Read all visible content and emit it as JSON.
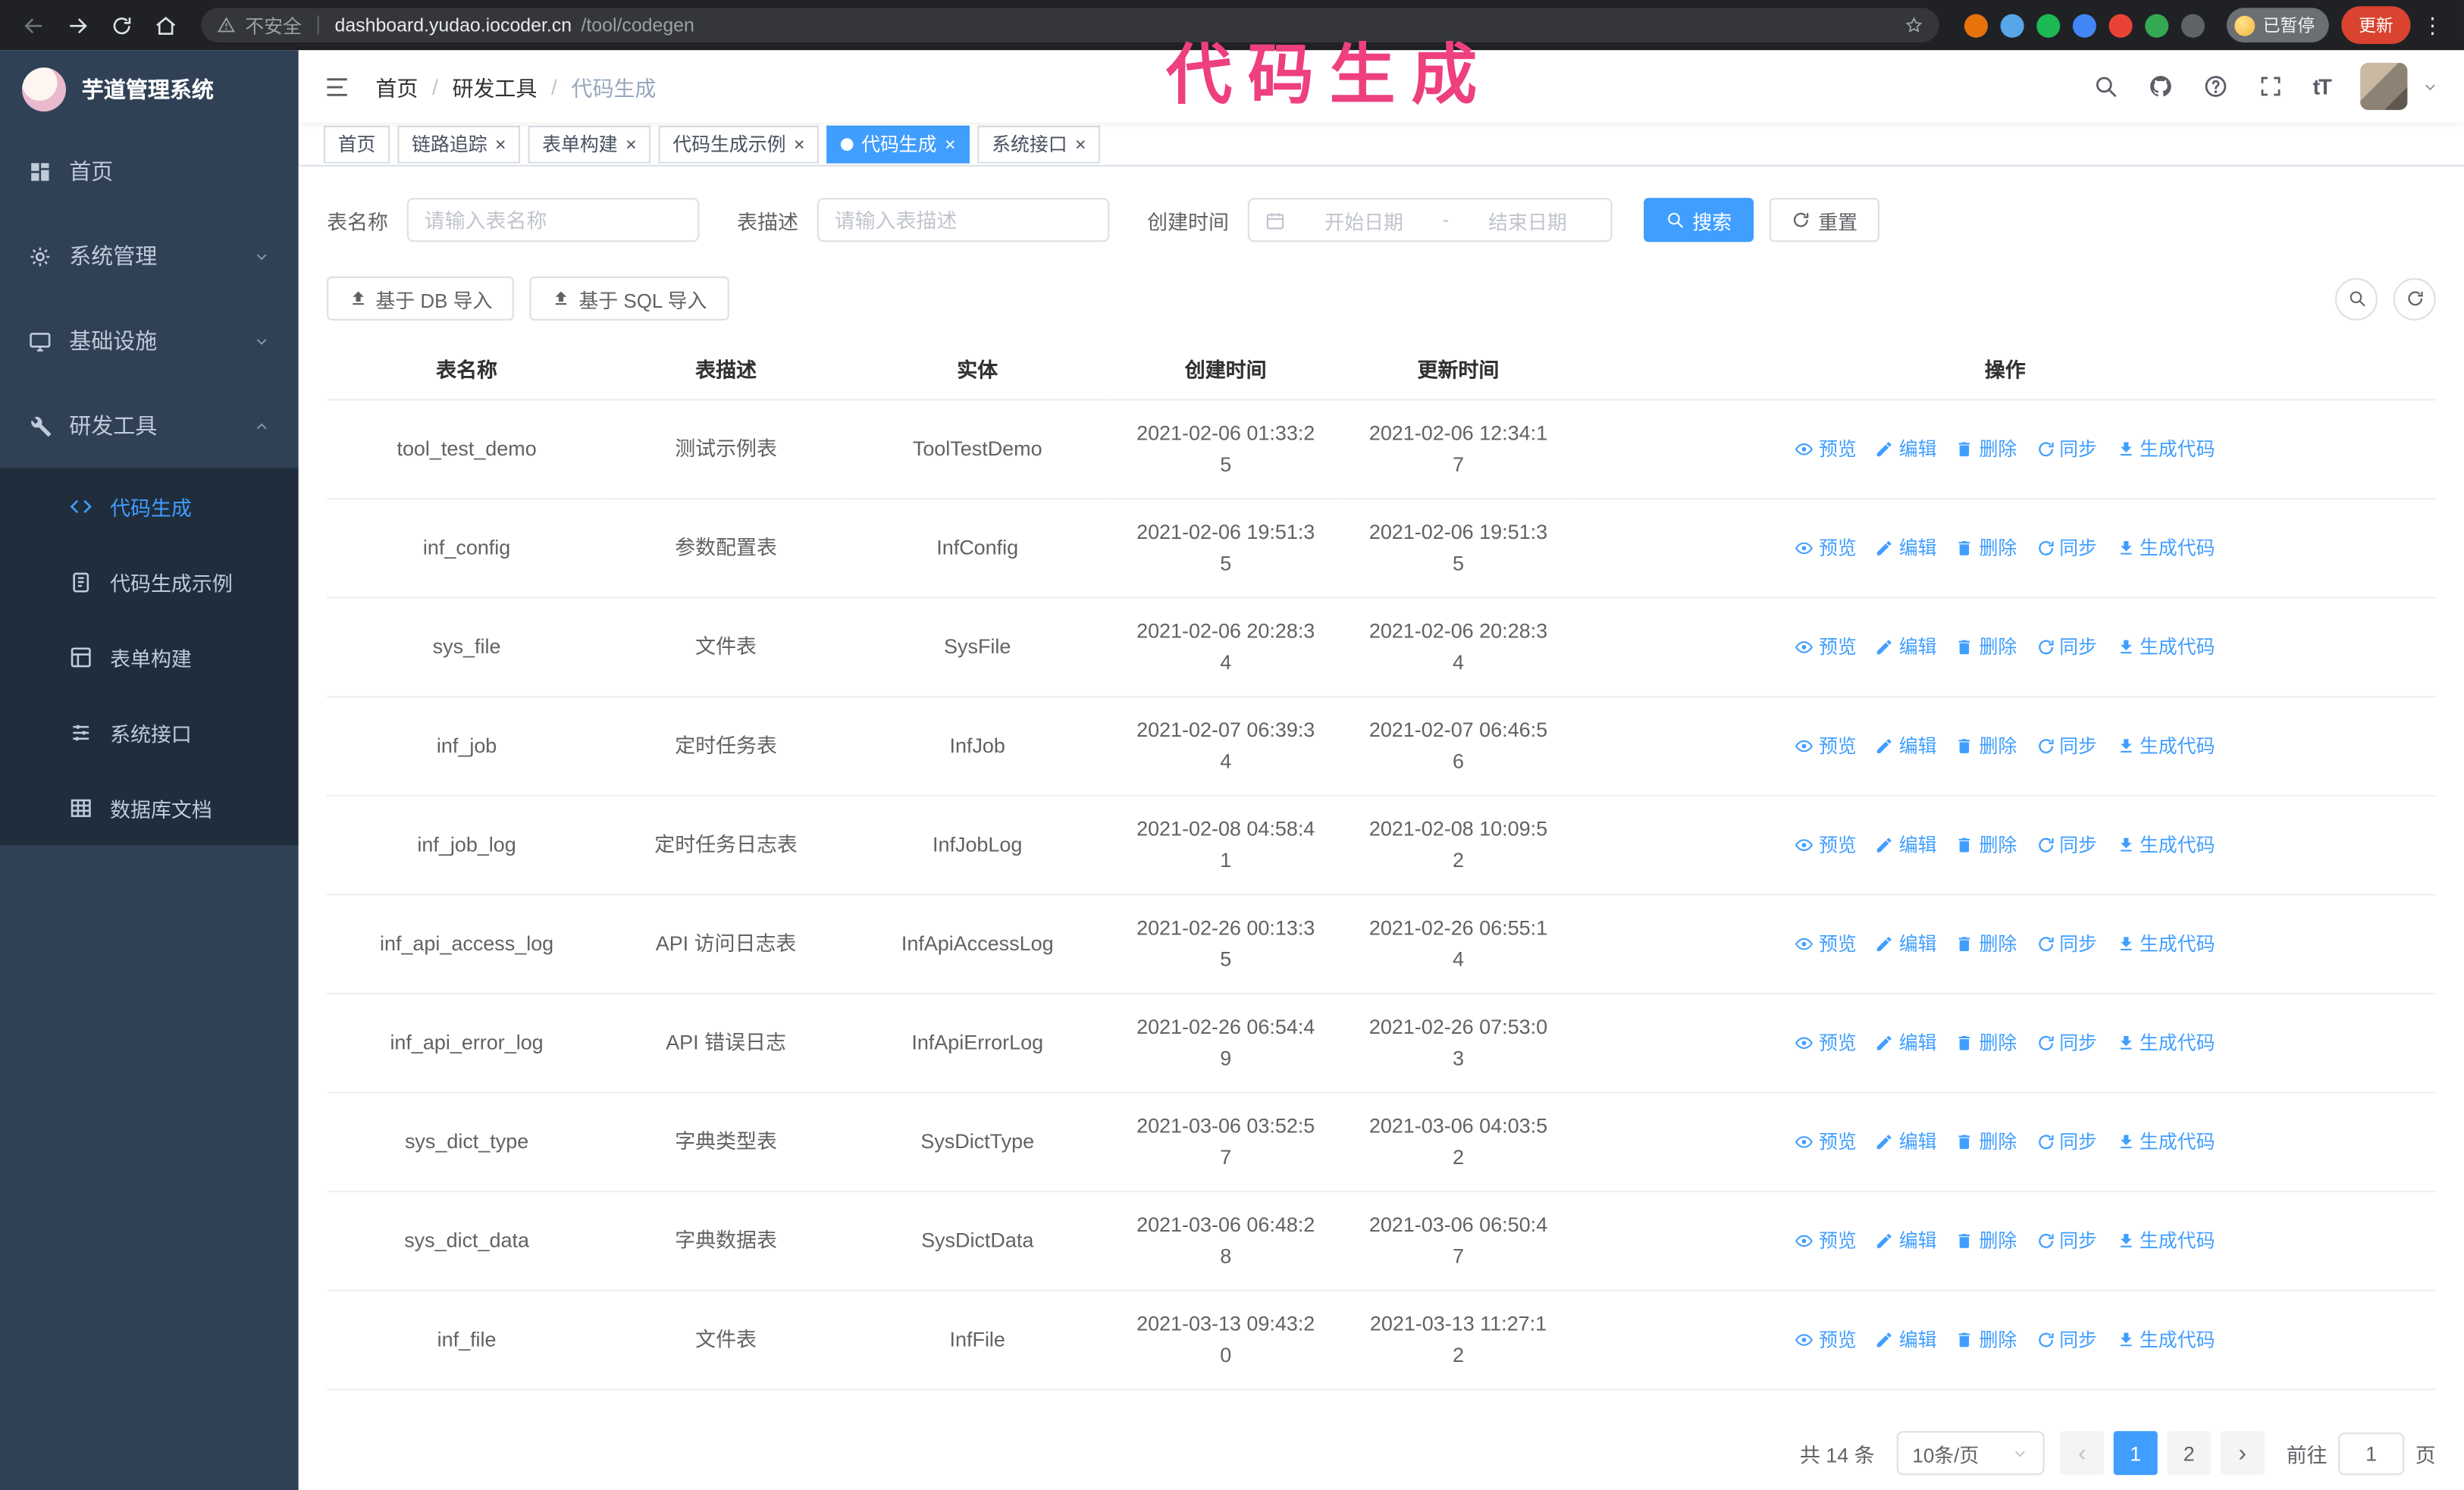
{
  "chrome": {
    "security_label": "不安全",
    "url_host": "dashboard.yudao.iocoder.cn",
    "url_path": "/tool/codegen",
    "extension_colors": [
      "#e8710a",
      "#58a6e8",
      "#1db954",
      "#4285f4",
      "#ea4335",
      "#34a853",
      "#5f6368"
    ],
    "paused_badge": "已暂停",
    "update_button": "更新"
  },
  "annotation": {
    "text": "代码生成",
    "color": "#ee3f7f"
  },
  "colors": {
    "primary": "#409eff",
    "sidebar_bg": "#304156",
    "submenu_bg": "#1f2d3d"
  },
  "sidebar": {
    "title": "芋道管理系统",
    "items": [
      {
        "label": "首页"
      },
      {
        "label": "系统管理"
      },
      {
        "label": "基础设施"
      },
      {
        "label": "研发工具"
      }
    ],
    "submenu": [
      {
        "label": "代码生成",
        "active": true
      },
      {
        "label": "代码生成示例",
        "active": false
      },
      {
        "label": "表单构建",
        "active": false
      },
      {
        "label": "系统接口",
        "active": false
      },
      {
        "label": "数据库文档",
        "active": false
      }
    ]
  },
  "header": {
    "breadcrumb": [
      "首页",
      "研发工具",
      "代码生成"
    ],
    "font_size_icon": "tT"
  },
  "tabs": [
    {
      "label": "首页",
      "closable": false,
      "active": false
    },
    {
      "label": "链路追踪",
      "closable": true,
      "active": false
    },
    {
      "label": "表单构建",
      "closable": true,
      "active": false
    },
    {
      "label": "代码生成示例",
      "closable": true,
      "active": false
    },
    {
      "label": "代码生成",
      "closable": true,
      "active": true
    },
    {
      "label": "系统接口",
      "closable": true,
      "active": false
    }
  ],
  "filters": {
    "table_name_label": "表名称",
    "table_name_placeholder": "请输入表名称",
    "table_desc_label": "表描述",
    "table_desc_placeholder": "请输入表描述",
    "create_time_label": "创建时间",
    "date_start_placeholder": "开始日期",
    "date_separator": "-",
    "date_end_placeholder": "结束日期",
    "search_button": "搜索",
    "reset_button": "重置"
  },
  "toolbar": {
    "import_db_button": "基于 DB 导入",
    "import_sql_button": "基于 SQL 导入"
  },
  "table": {
    "columns": [
      "表名称",
      "表描述",
      "实体",
      "创建时间",
      "更新时间",
      "操作"
    ],
    "action_labels": [
      "预览",
      "编辑",
      "删除",
      "同步",
      "生成代码"
    ],
    "rows": [
      {
        "name": "tool_test_demo",
        "desc": "测试示例表",
        "entity": "ToolTestDemo",
        "created": "2021-02-06 01:33:25",
        "updated": "2021-02-06 12:34:17"
      },
      {
        "name": "inf_config",
        "desc": "参数配置表",
        "entity": "InfConfig",
        "created": "2021-02-06 19:51:35",
        "updated": "2021-02-06 19:51:35"
      },
      {
        "name": "sys_file",
        "desc": "文件表",
        "entity": "SysFile",
        "created": "2021-02-06 20:28:34",
        "updated": "2021-02-06 20:28:34"
      },
      {
        "name": "inf_job",
        "desc": "定时任务表",
        "entity": "InfJob",
        "created": "2021-02-07 06:39:34",
        "updated": "2021-02-07 06:46:56"
      },
      {
        "name": "inf_job_log",
        "desc": "定时任务日志表",
        "entity": "InfJobLog",
        "created": "2021-02-08 04:58:41",
        "updated": "2021-02-08 10:09:52"
      },
      {
        "name": "inf_api_access_log",
        "desc": "API 访问日志表",
        "entity": "InfApiAccessLog",
        "created": "2021-02-26 00:13:35",
        "updated": "2021-02-26 06:55:14"
      },
      {
        "name": "inf_api_error_log",
        "desc": "API 错误日志",
        "entity": "InfApiErrorLog",
        "created": "2021-02-26 06:54:49",
        "updated": "2021-02-26 07:53:03"
      },
      {
        "name": "sys_dict_type",
        "desc": "字典类型表",
        "entity": "SysDictType",
        "created": "2021-03-06 03:52:57",
        "updated": "2021-03-06 04:03:52"
      },
      {
        "name": "sys_dict_data",
        "desc": "字典数据表",
        "entity": "SysDictData",
        "created": "2021-03-06 06:48:28",
        "updated": "2021-03-06 06:50:47"
      },
      {
        "name": "inf_file",
        "desc": "文件表",
        "entity": "InfFile",
        "created": "2021-03-13 09:43:20",
        "updated": "2021-03-13 11:27:12"
      }
    ]
  },
  "pagination": {
    "total_text": "共 14 条",
    "page_size_text": "10条/页",
    "pages": [
      "1",
      "2"
    ],
    "active_page": "1",
    "goto_prefix": "前往",
    "goto_value": "1",
    "goto_suffix": "页"
  }
}
